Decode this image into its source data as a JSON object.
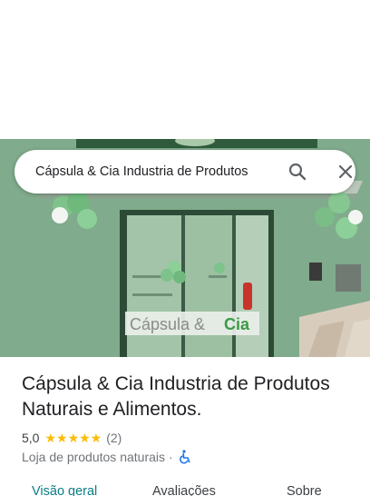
{
  "search": {
    "query": "Cápsula & Cia Industria de Produtos"
  },
  "photo": {
    "sign_text": "Cápsula & Cia"
  },
  "place": {
    "title": "Cápsula & Cia Industria de Produtos Naturais e Alimentos.",
    "rating": "5,0",
    "stars": "★★★★★",
    "review_count": "(2)",
    "category": "Loja de produtos naturais",
    "separator": "·"
  },
  "tabs": [
    {
      "label": "Visão geral",
      "active": true
    },
    {
      "label": "Avaliações",
      "active": false
    },
    {
      "label": "Sobre",
      "active": false
    }
  ],
  "colors": {
    "accent": "#0b7c86",
    "star": "#fbbc04",
    "wheelchair": "#1a73e8"
  }
}
